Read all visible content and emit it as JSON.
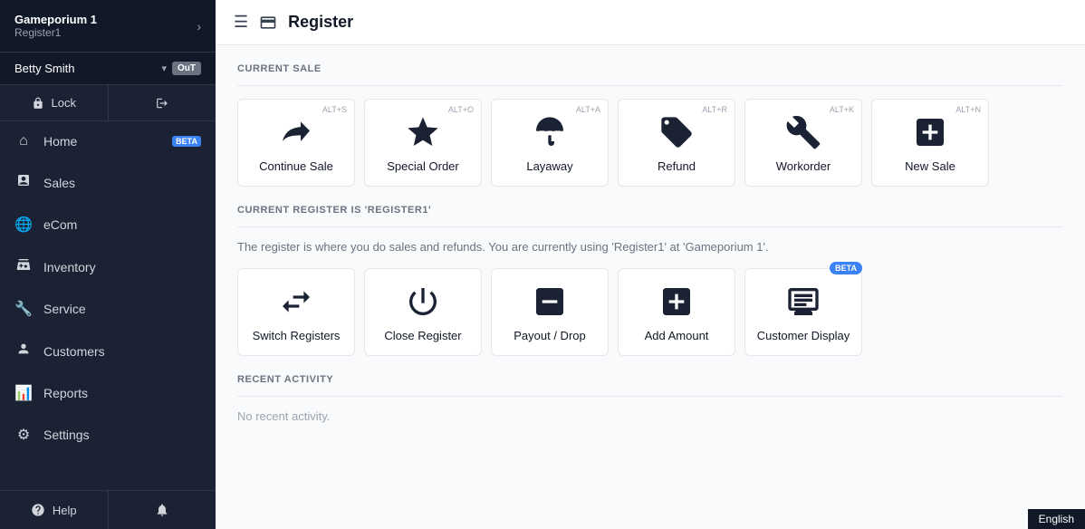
{
  "store": {
    "name": "Gameporium 1",
    "register": "Register1"
  },
  "user": {
    "name": "Betty Smith",
    "status": "OuT"
  },
  "sidebar": {
    "lock_label": "Lock",
    "logout_label": "",
    "nav_items": [
      {
        "id": "home",
        "label": "Home",
        "icon": "home",
        "badge": "BETA"
      },
      {
        "id": "sales",
        "label": "Sales",
        "icon": "sales",
        "badge": null
      },
      {
        "id": "ecom",
        "label": "eCom",
        "icon": "ecom",
        "badge": null
      },
      {
        "id": "inventory",
        "label": "Inventory",
        "icon": "inventory",
        "badge": null
      },
      {
        "id": "service",
        "label": "Service",
        "icon": "service",
        "badge": null
      },
      {
        "id": "customers",
        "label": "Customers",
        "icon": "customers",
        "badge": null
      },
      {
        "id": "reports",
        "label": "Reports",
        "icon": "reports",
        "badge": null
      },
      {
        "id": "settings",
        "label": "Settings",
        "icon": "settings",
        "badge": null
      }
    ],
    "help_label": "Help"
  },
  "topbar": {
    "title": "Register"
  },
  "current_sale": {
    "section_title": "CURRENT SALE",
    "cards": [
      {
        "id": "continue-sale",
        "label": "Continue Sale",
        "shortcut": "ALT+S"
      },
      {
        "id": "special-order",
        "label": "Special Order",
        "shortcut": "ALT+O"
      },
      {
        "id": "layaway",
        "label": "Layaway",
        "shortcut": "ALT+A"
      },
      {
        "id": "refund",
        "label": "Refund",
        "shortcut": "ALT+R"
      },
      {
        "id": "workorder",
        "label": "Workorder",
        "shortcut": "ALT+K"
      },
      {
        "id": "new-sale",
        "label": "New Sale",
        "shortcut": "ALT+N"
      }
    ]
  },
  "register_section": {
    "title": "CURRENT REGISTER IS 'REGISTER1'",
    "info_text": "The register is where you do sales and refunds. You are currently using 'Register1'  at 'Gameporium 1'.",
    "cards": [
      {
        "id": "switch-registers",
        "label": "Switch Registers",
        "shortcut": null,
        "beta": false
      },
      {
        "id": "close-register",
        "label": "Close Register",
        "shortcut": null,
        "beta": false
      },
      {
        "id": "payout-drop",
        "label": "Payout / Drop",
        "shortcut": null,
        "beta": false
      },
      {
        "id": "add-amount",
        "label": "Add Amount",
        "shortcut": null,
        "beta": false
      },
      {
        "id": "customer-display",
        "label": "Customer Display",
        "shortcut": null,
        "beta": true
      }
    ]
  },
  "recent_activity": {
    "title": "RECENT ACTIVITY",
    "no_activity_text": "No recent activity."
  },
  "footer": {
    "language": "English"
  }
}
